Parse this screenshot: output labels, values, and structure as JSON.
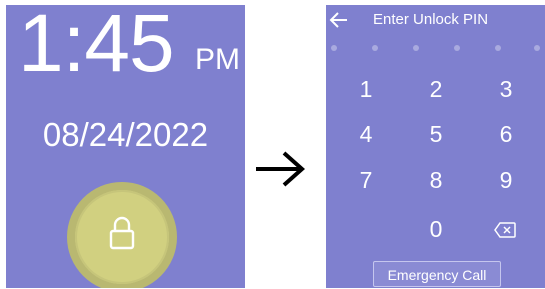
{
  "lock_screen": {
    "time": "1:45",
    "ampm": "PM",
    "date": "08/24/2022",
    "lock_icon": "lock-icon"
  },
  "transition": {
    "arrow_icon": "right-arrow-icon"
  },
  "pin_screen": {
    "title": "Enter Unlock PIN",
    "back_icon": "back-arrow-icon",
    "pin_dots_count": 6,
    "keys": [
      "1",
      "2",
      "3",
      "4",
      "5",
      "6",
      "7",
      "8",
      "9",
      "0"
    ],
    "delete_icon": "backspace-icon",
    "emergency_label": "Emergency Call"
  },
  "colors": {
    "screen_bg": "#7f80cf",
    "lock_button": "#d1d080",
    "text": "#ffffff"
  }
}
